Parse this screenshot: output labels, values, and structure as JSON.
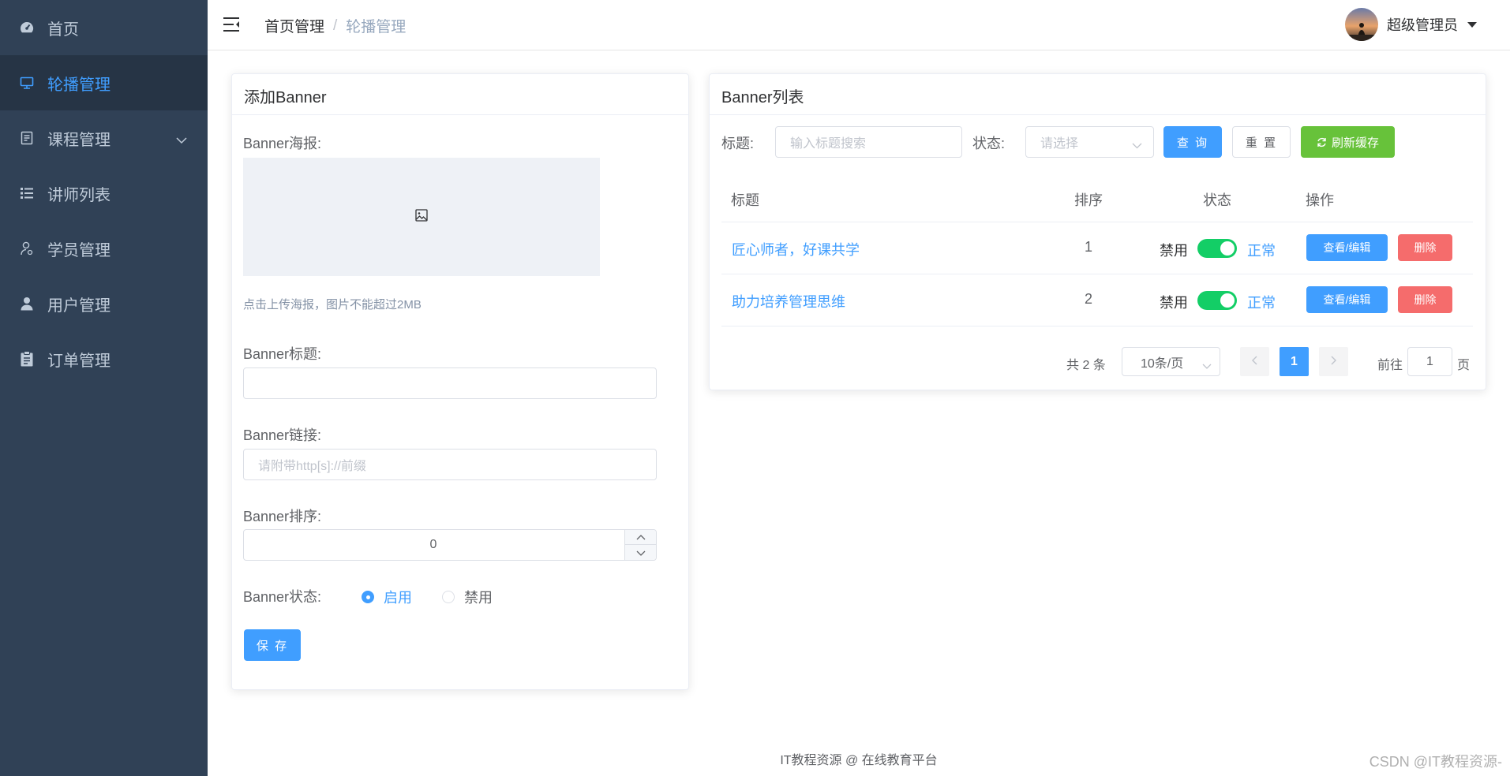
{
  "sidebar": {
    "items": [
      {
        "label": "首页",
        "icon": "dashboard-icon"
      },
      {
        "label": "轮播管理",
        "icon": "monitor-icon",
        "active": true
      },
      {
        "label": "课程管理",
        "icon": "document-icon",
        "expandable": true
      },
      {
        "label": "讲师列表",
        "icon": "list-icon"
      },
      {
        "label": "学员管理",
        "icon": "student-icon"
      },
      {
        "label": "用户管理",
        "icon": "user-icon"
      },
      {
        "label": "订单管理",
        "icon": "clipboard-icon"
      }
    ]
  },
  "header": {
    "breadcrumb_home": "首页管理",
    "breadcrumb_sep": "/",
    "breadcrumb_current": "轮播管理",
    "username": "超级管理员"
  },
  "add_form": {
    "title": "添加Banner",
    "poster_label": "Banner海报:",
    "upload_tip": "点击上传海报，图片不能超过2MB",
    "title_label": "Banner标题:",
    "title_value": "",
    "link_label": "Banner链接:",
    "link_placeholder": "请附带http[s]://前缀",
    "sort_label": "Banner排序:",
    "sort_value": "0",
    "status_label": "Banner状态:",
    "status_enable": "启用",
    "status_disable": "禁用",
    "status_selected": "启用",
    "save_label": "保 存"
  },
  "list": {
    "title": "Banner列表",
    "filter_title_label": "标题:",
    "filter_title_placeholder": "输入标题搜索",
    "filter_status_label": "状态:",
    "filter_status_placeholder": "请选择",
    "query_label": "查 询",
    "reset_label": "重 置",
    "refresh_label": "刷新缓存",
    "columns": [
      "标题",
      "排序",
      "状态",
      "操作"
    ],
    "rows": [
      {
        "title": "匠心师者，好课共学",
        "sort": "1",
        "off_text": "禁用",
        "on_text": "正常",
        "enabled": true,
        "edit": "查看/编辑",
        "delete": "删除"
      },
      {
        "title": "助力培养管理思维",
        "sort": "2",
        "off_text": "禁用",
        "on_text": "正常",
        "enabled": true,
        "edit": "查看/编辑",
        "delete": "删除"
      }
    ],
    "pagination": {
      "total_text": "共 2 条",
      "page_size": "10条/页",
      "current_page": "1",
      "goto_label": "前往",
      "goto_value": "1",
      "goto_suffix": "页"
    }
  },
  "footer": {
    "text": "IT教程资源 @ 在线教育平台"
  },
  "watermark": "CSDN @IT教程资源-",
  "colors": {
    "sidebar_bg": "#304156",
    "primary": "#409eff",
    "success": "#67c23a",
    "danger": "#f56c6c",
    "switch_on": "#13ce66"
  }
}
